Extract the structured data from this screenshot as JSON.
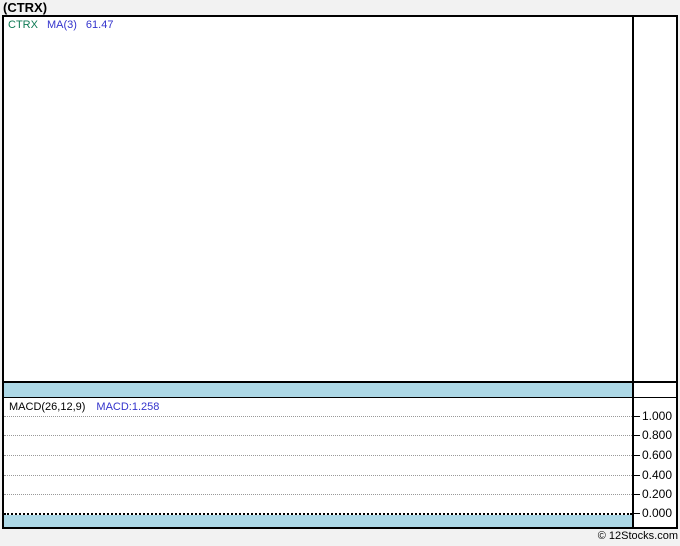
{
  "page": {
    "title": "(CTRX)",
    "credit": "© 12Stocks.com",
    "background_color": "#F2F2F2"
  },
  "colors": {
    "panel_background": "#FFFFFF",
    "frame_border": "#000000",
    "separator_band": "#ADD8E6",
    "ticker_green": "#0E7A54",
    "indicator_blue": "#3333CC",
    "gridline_gray": "#999999"
  },
  "price_panel": {
    "legend": {
      "ticker": "CTRX",
      "ma_label": "MA(3)",
      "ma_value": "61.47"
    }
  },
  "macd_panel": {
    "label": "MACD(26,12,9)",
    "value_label": "MACD:1.258",
    "axis_ticks": [
      "1.000",
      "0.800",
      "0.600",
      "0.400",
      "0.200",
      "0.000"
    ]
  },
  "chart_data": [
    {
      "type": "line",
      "title": "CTRX price panel",
      "legend": [
        "CTRX",
        "MA(3)"
      ],
      "annotations": [
        "MA(3) latest value 61.47"
      ],
      "series": [],
      "grid": false,
      "note": "plot area rendered empty - no price data visible"
    },
    {
      "type": "line",
      "title": "MACD(26,12,9)",
      "legend": [
        "MACD"
      ],
      "latest_value": 1.258,
      "yticks": [
        1.0,
        0.8,
        0.6,
        0.4,
        0.2,
        0.0
      ],
      "ylim": [
        -0.12,
        1.12
      ],
      "axis_side": "right",
      "grid": true,
      "series": [],
      "note": "plot area rendered empty - no MACD curve visible; zero line drawn as bold dotted black"
    }
  ]
}
